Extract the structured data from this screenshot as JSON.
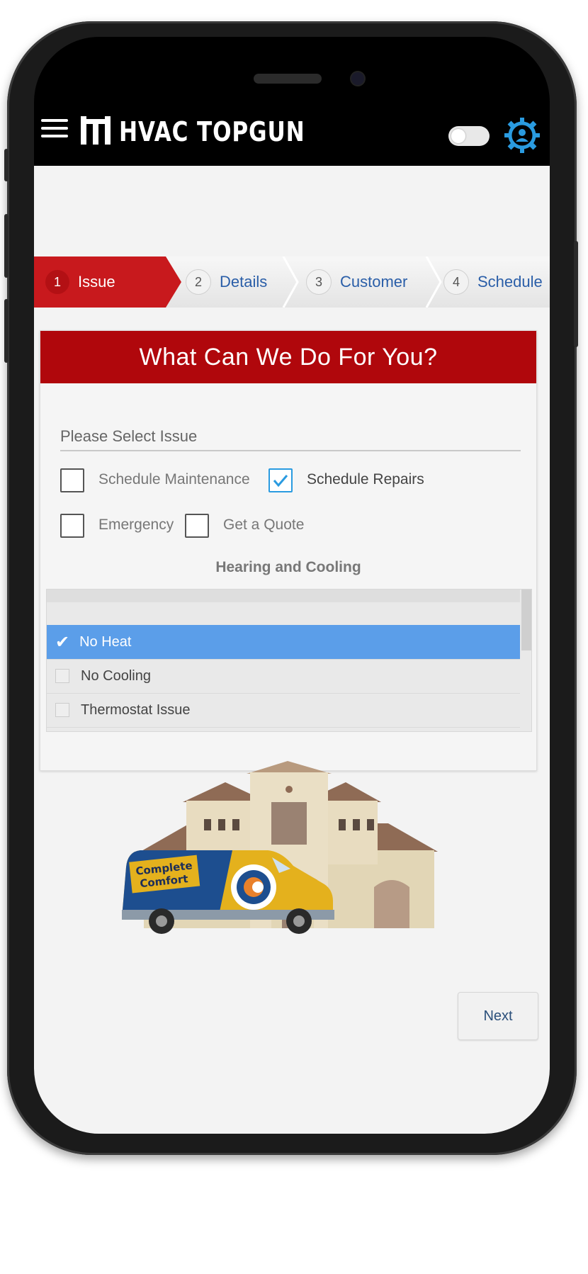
{
  "app": {
    "title": "HVAC TOPGUN"
  },
  "stepper": {
    "steps": [
      {
        "num": "1",
        "label": "Issue"
      },
      {
        "num": "2",
        "label": "Details"
      },
      {
        "num": "3",
        "label": "Customer"
      },
      {
        "num": "4",
        "label": "Schedule"
      }
    ]
  },
  "card": {
    "title": "What Can We Do For You?",
    "select_label": "Please Select Issue",
    "options": [
      {
        "label": "Schedule Maintenance",
        "checked": false
      },
      {
        "label": "Schedule Repairs",
        "checked": true
      },
      {
        "label": "Emergency",
        "checked": false
      },
      {
        "label": "Get a Quote",
        "checked": false
      }
    ],
    "list_title": "Hearing and Cooling",
    "list_items": [
      {
        "label": "No Heat",
        "selected": true
      },
      {
        "label": "No Cooling",
        "selected": false
      },
      {
        "label": "Thermostat Issue",
        "selected": false
      }
    ]
  },
  "illustration": {
    "van_line1": "Complete",
    "van_line2": "Comfort"
  },
  "footer": {
    "next_label": "Next"
  },
  "colors": {
    "brand_red": "#b0070c",
    "step_active": "#c8191d",
    "selected_blue": "#5b9ee9",
    "link_blue": "#2a5ea8",
    "settings_blue": "#2a9be0"
  },
  "icons": [
    "hamburger-icon",
    "logo-icon",
    "toggle-switch",
    "settings-gear-icon",
    "check-icon",
    "house-icon",
    "van-icon"
  ]
}
